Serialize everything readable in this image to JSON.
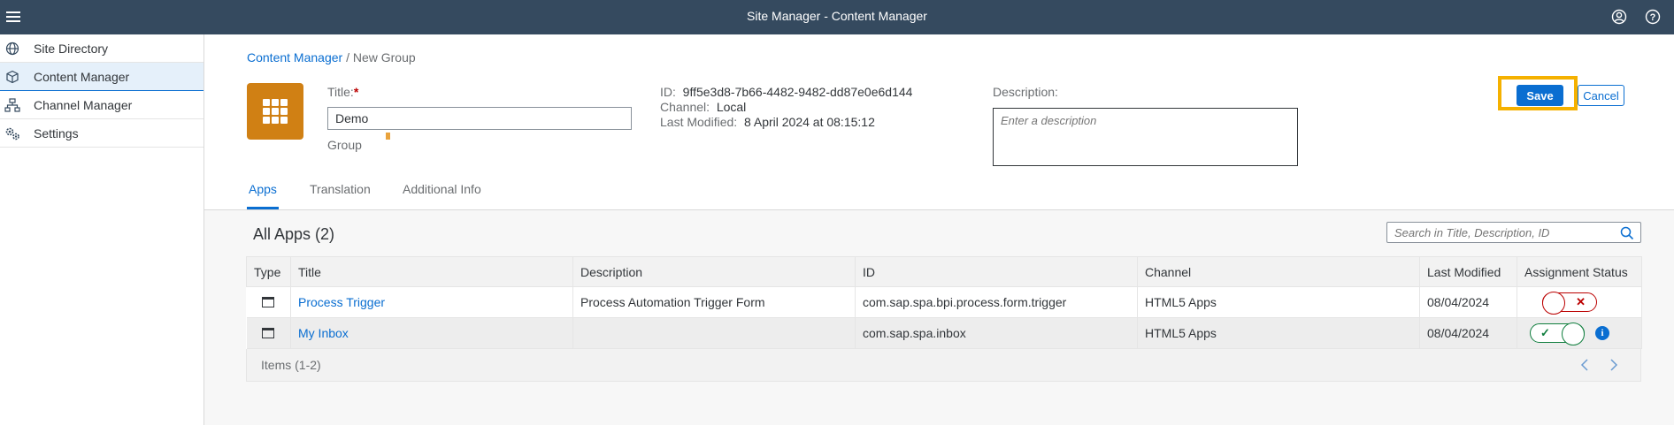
{
  "shell": {
    "title": "Site Manager - Content Manager",
    "menu_icon": "hamburger-icon",
    "user_icon": "user-icon",
    "help_icon": "help-icon"
  },
  "sidebar": {
    "items": [
      {
        "label": "Site Directory",
        "icon": "globe-icon",
        "active": false
      },
      {
        "label": "Content Manager",
        "icon": "cube-icon",
        "active": true
      },
      {
        "label": "Channel Manager",
        "icon": "hierarchy-icon",
        "active": false
      },
      {
        "label": "Settings",
        "icon": "gears-icon",
        "active": false
      }
    ]
  },
  "breadcrumb": {
    "link": "Content Manager",
    "separator": " / ",
    "current": "New Group"
  },
  "header": {
    "tile_icon": "app-grid-icon",
    "title_label": "Title:",
    "required_marker": "*",
    "title_value": "Demo",
    "type_label": "Group",
    "id_label": "ID:",
    "id_value": "9ff5e3d8-7b66-4482-9482-dd87e0e6d144",
    "channel_label": "Channel:",
    "channel_value": "Local",
    "modified_label": "Last Modified:",
    "modified_value": "8 April 2024 at 08:15:12",
    "description_label": "Description:",
    "description_placeholder": "Enter a description",
    "save_label": "Save",
    "cancel_label": "Cancel",
    "highlight_color": "#f5b100"
  },
  "tabs": [
    {
      "label": "Apps",
      "active": true
    },
    {
      "label": "Translation",
      "active": false
    },
    {
      "label": "Additional Info",
      "active": false
    }
  ],
  "apps": {
    "heading": "All Apps (2)",
    "search_placeholder": "Search in Title, Description, ID",
    "columns": [
      "Type",
      "Title",
      "Description",
      "ID",
      "Channel",
      "Last Modified",
      "Assignment Status"
    ],
    "rows": [
      {
        "type_icon": "window-icon",
        "title": "Process Trigger",
        "description": "Process Automation Trigger Form",
        "id": "com.sap.spa.bpi.process.form.trigger",
        "channel": "HTML5 Apps",
        "modified": "08/04/2024",
        "assigned": false,
        "status_mark": "✕"
      },
      {
        "type_icon": "window-icon",
        "title": "My Inbox",
        "description": "",
        "id": "com.sap.spa.inbox",
        "channel": "HTML5 Apps",
        "modified": "08/04/2024",
        "assigned": true,
        "status_mark": "✓",
        "info_glyph": "i"
      }
    ],
    "items_text": "Items (1-2)"
  },
  "colors": {
    "shell_bg": "#354a5f",
    "accent": "#0a6ed1",
    "tile": "#d08014",
    "negative": "#bb0000",
    "positive": "#107e3e"
  }
}
